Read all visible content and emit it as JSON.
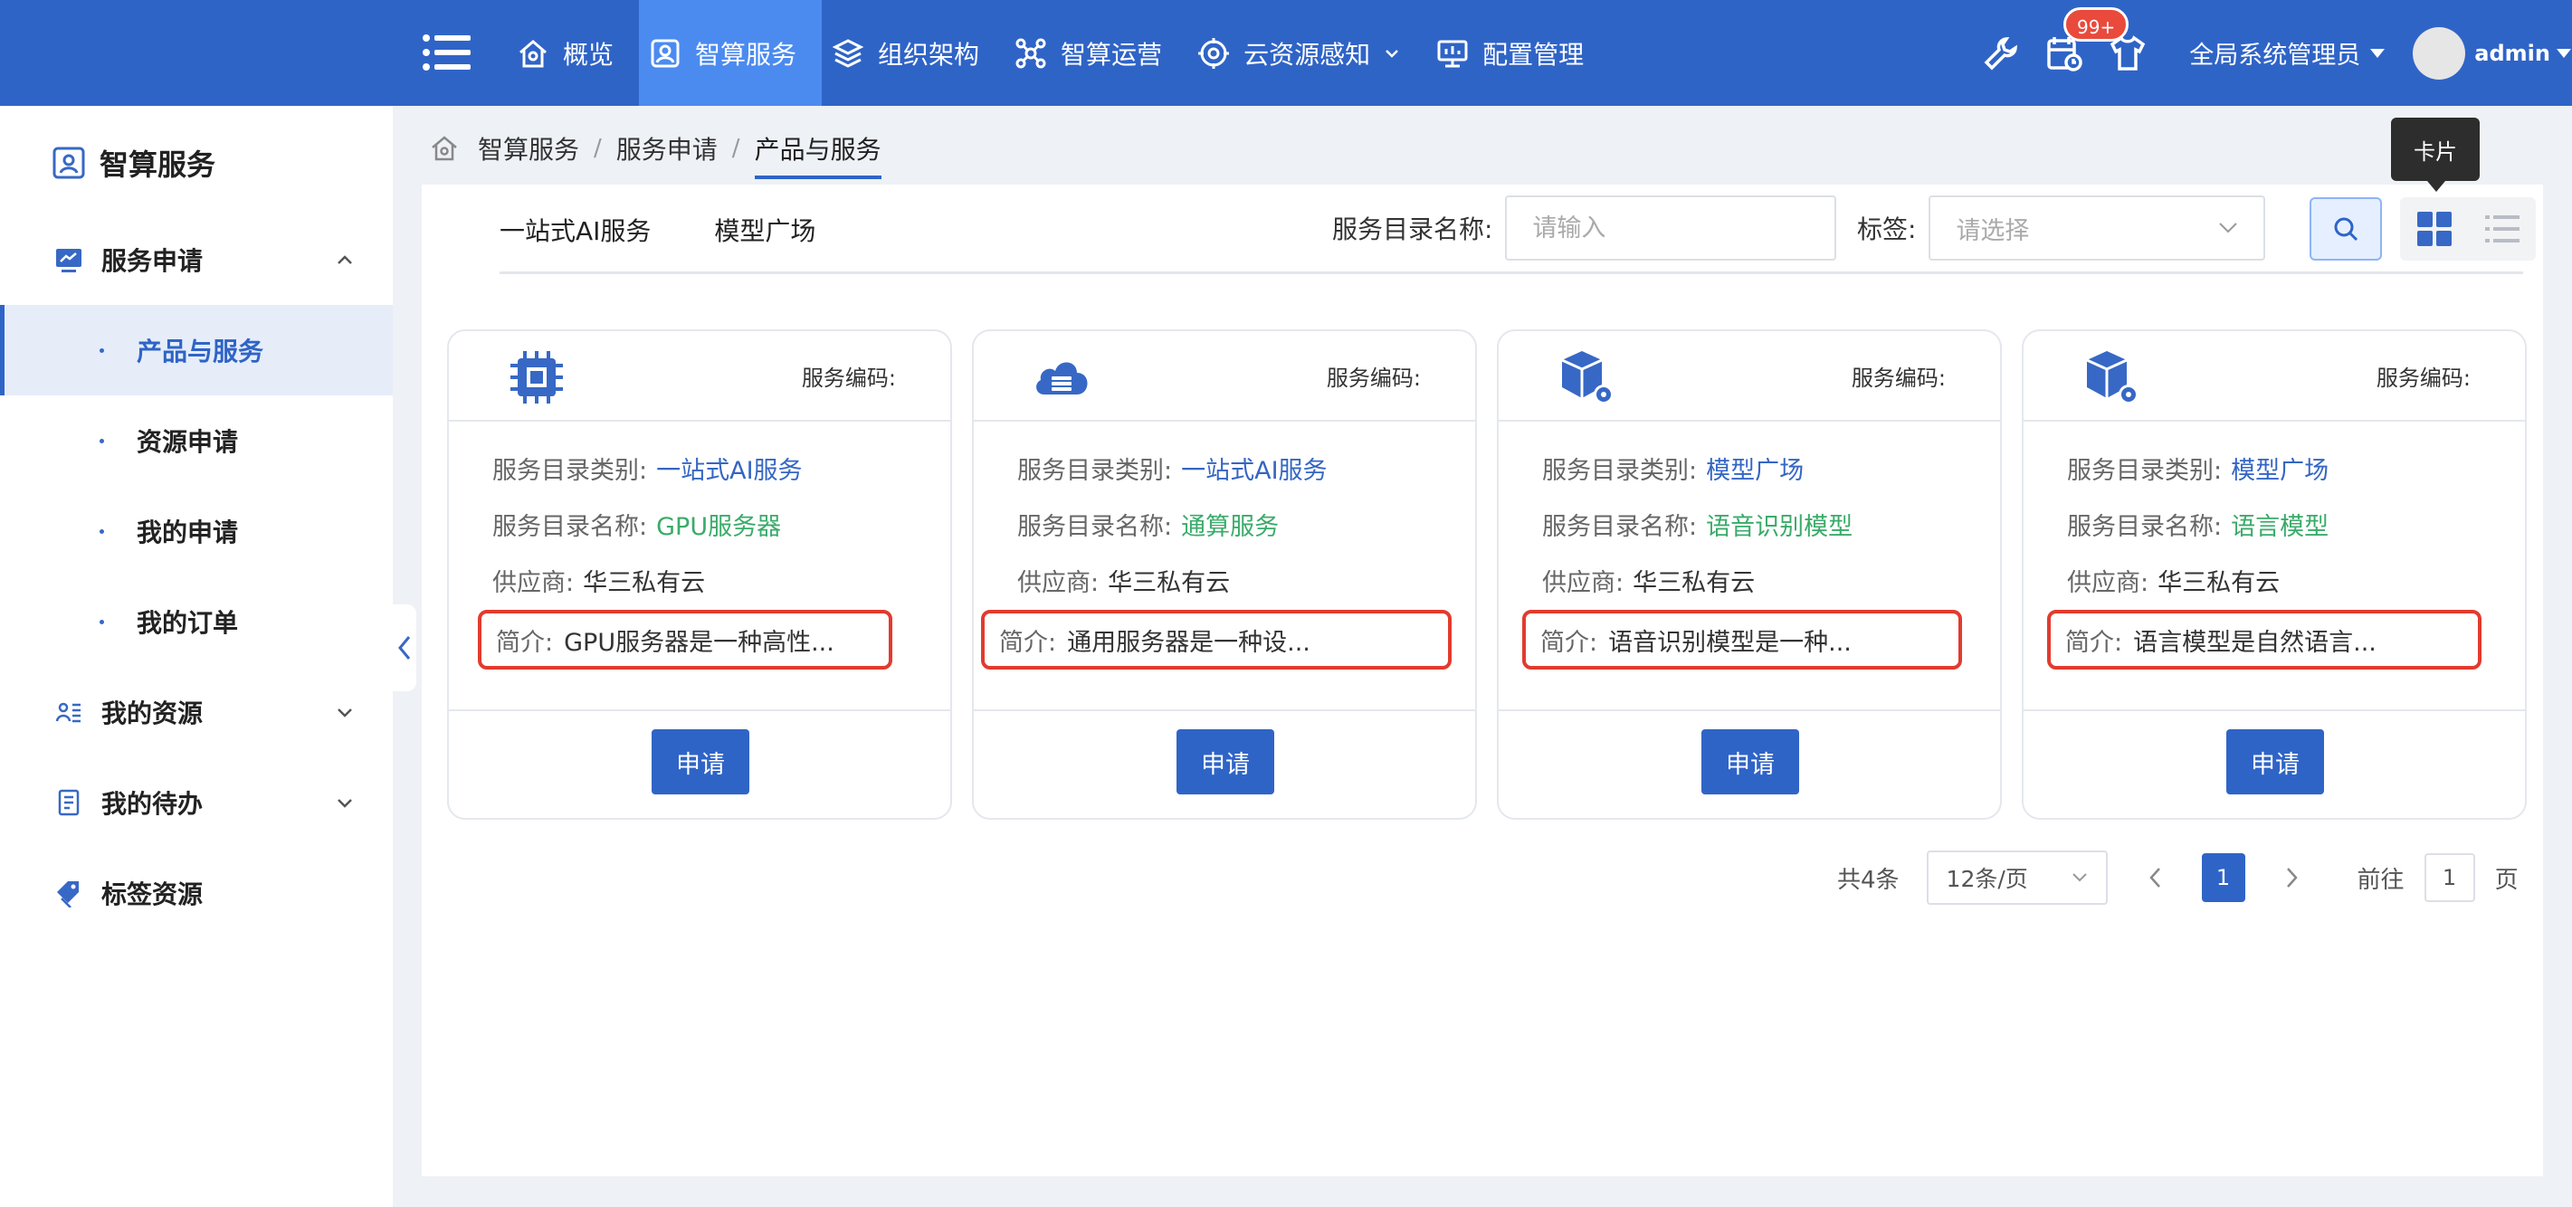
{
  "topbar": {
    "nav": [
      {
        "label": "概览",
        "icon": "home-icon"
      },
      {
        "label": "智算服务",
        "icon": "user-card-icon",
        "active": true
      },
      {
        "label": "组织架构",
        "icon": "layers-icon"
      },
      {
        "label": "智算运营",
        "icon": "network-icon"
      },
      {
        "label": "云资源感知",
        "icon": "cloud-sense-icon"
      },
      {
        "label": "配置管理",
        "icon": "monitor-icon"
      }
    ],
    "badge": "99+",
    "role": "全局系统管理员",
    "user": "admin"
  },
  "sidebar": {
    "title": "智算服务",
    "groups": [
      {
        "label": "服务申请",
        "icon": "chart-icon",
        "expanded": true
      },
      {
        "label": "我的资源",
        "icon": "id-card-icon"
      },
      {
        "label": "我的待办",
        "icon": "note-icon"
      },
      {
        "label": "标签资源",
        "icon": "tag-icon"
      }
    ],
    "subitems": [
      {
        "label": "产品与服务",
        "active": true
      },
      {
        "label": "资源申请"
      },
      {
        "label": "我的申请"
      },
      {
        "label": "我的订单"
      }
    ]
  },
  "breadcrumb": [
    "智算服务",
    "服务申请",
    "产品与服务"
  ],
  "breadcrumb_sep": "/",
  "tabs": [
    "一站式AI服务",
    "模型广场"
  ],
  "filters": {
    "name_label": "服务目录名称:",
    "name_placeholder": "请输入",
    "tag_label": "标签:",
    "tag_placeholder": "请选择"
  },
  "tooltip": "卡片",
  "card_labels": {
    "code": "服务编码:",
    "category": "服务目录类别:",
    "name": "服务目录名称:",
    "supplier": "供应商:",
    "intro": "简介:",
    "apply": "申请"
  },
  "cards": [
    {
      "icon": "chip-icon",
      "category": "一站式AI服务",
      "name": "GPU服务器",
      "supplier": "华三私有云",
      "intro": "GPU服务器是一种高性..."
    },
    {
      "icon": "cloud-server-icon",
      "category": "一站式AI服务",
      "name": "通算服务",
      "supplier": "华三私有云",
      "intro": "通用服务器是一种设..."
    },
    {
      "icon": "model-box-icon",
      "category": "模型广场",
      "name": "语音识别模型",
      "supplier": "华三私有云",
      "intro": "语音识别模型是一种..."
    },
    {
      "icon": "model-box-icon",
      "category": "模型广场",
      "name": "语言模型",
      "supplier": "华三私有云",
      "intro": "语言模型是自然语言..."
    }
  ],
  "pagination": {
    "total": "共4条",
    "page_size": "12条/页",
    "current": "1",
    "goto_label": "前往",
    "goto_value": "1",
    "page_label": "页"
  },
  "colors": {
    "primary": "#2f64c7",
    "highlight_border": "#e23b2e",
    "link_blue": "#3566c3",
    "link_green": "#3aab6a"
  }
}
